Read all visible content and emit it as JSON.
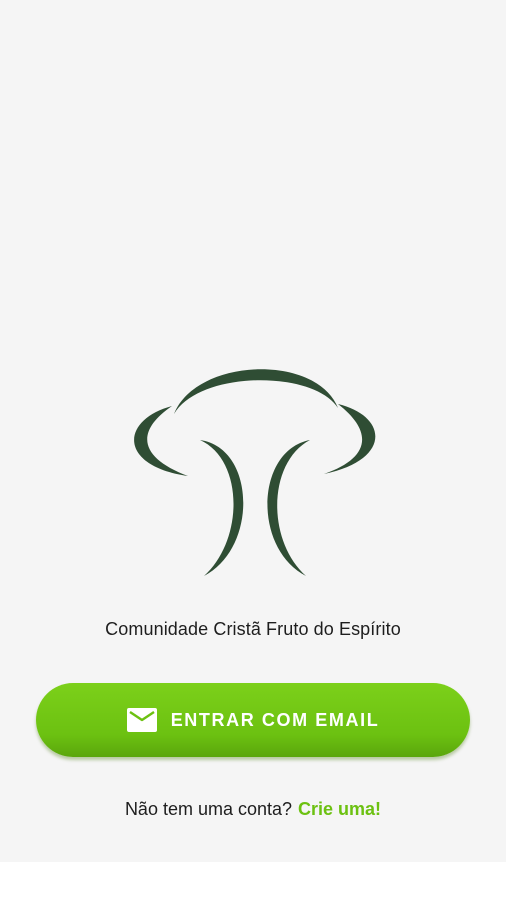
{
  "app": {
    "name": "Comunidade Cristã Fruto do Espírito",
    "logo_icon": "tree-logo-icon"
  },
  "login": {
    "email_button_label": "ENTRAR COM EMAIL",
    "email_icon": "mail-icon"
  },
  "signup": {
    "prompt": "Não tem uma conta?",
    "link_label": "Crie uma!"
  },
  "colors": {
    "accent_green": "#6cc111",
    "logo_green": "#2f4d34",
    "background": "#f5f5f5"
  }
}
